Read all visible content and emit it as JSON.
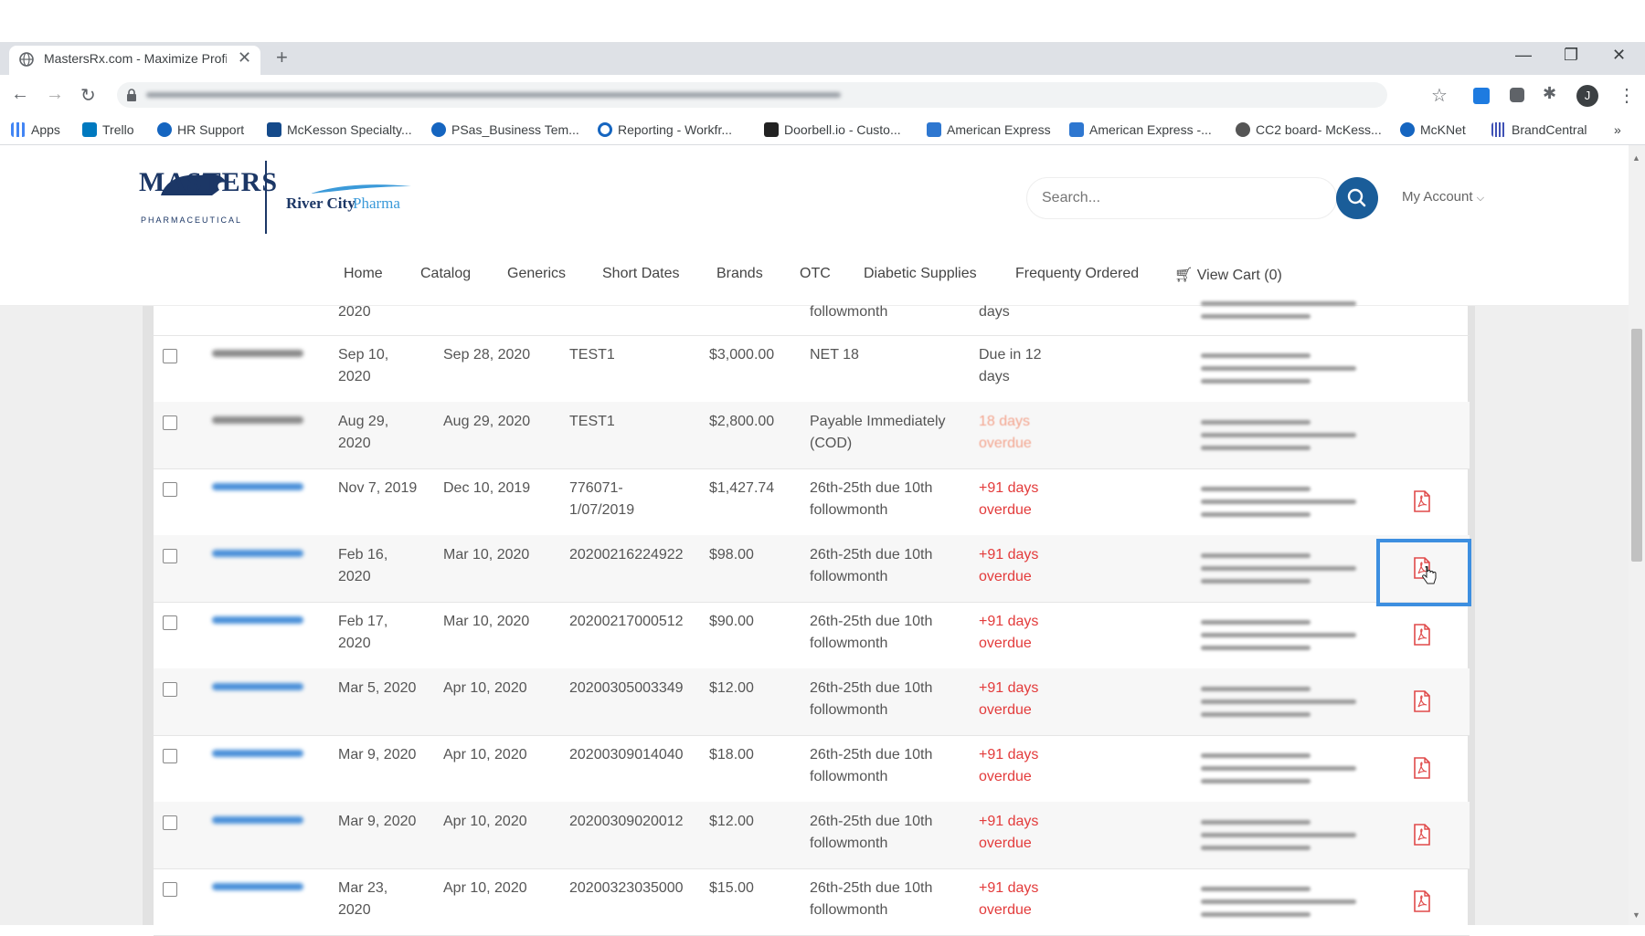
{
  "browser": {
    "tab_title": "MastersRx.com - Maximize Profit",
    "bookmarks": [
      "Apps",
      "Trello",
      "HR Support",
      "McKesson Specialty...",
      "PSas_Business Tem...",
      "Reporting - Workfr...",
      "Doorbell.io - Custo...",
      "American Express",
      "American Express -...",
      "CC2 board- McKess...",
      "McKNet",
      "BrandCentral"
    ],
    "profile_initial": "J"
  },
  "header": {
    "logo_masters": "MASTERS",
    "logo_masters_sub": "PHARMACEUTICAL",
    "logo_rcp_bold": "River City",
    "logo_rcp_light": "Pharma",
    "search_placeholder": "Search...",
    "my_account": "My Account"
  },
  "nav": [
    "Home",
    "Catalog",
    "Generics",
    "Short Dates",
    "Brands",
    "OTC",
    "Diabetic Supplies",
    "Frequenty Ordered",
    "View Cart (0)"
  ],
  "partial_row": {
    "date_line2": "2020",
    "terms_line2": "followmonth",
    "status_line2": "days"
  },
  "rows": [
    {
      "inv_date": [
        "Sep 10,",
        "2020"
      ],
      "due_date": "Sep 28, 2020",
      "ref": [
        "TEST1"
      ],
      "amount": "$3,000.00",
      "terms": [
        "NET 18"
      ],
      "status": [
        "Due in 12",
        "days"
      ],
      "status_type": "normal",
      "pdf": false
    },
    {
      "inv_date": [
        "Aug 29,",
        "2020"
      ],
      "due_date": "Aug 29, 2020",
      "ref": [
        "TEST1"
      ],
      "amount": "$2,800.00",
      "terms": [
        "Payable Immediately",
        "(COD)"
      ],
      "status": [
        "18 days",
        "overdue"
      ],
      "status_type": "faint",
      "pdf": false
    },
    {
      "inv_date": [
        "Nov 7, 2019"
      ],
      "due_date": "Dec 10, 2019",
      "ref": [
        "776071-",
        "1/07/2019"
      ],
      "amount": "$1,427.74",
      "terms": [
        "26th-25th due 10th",
        "followmonth"
      ],
      "status": [
        "+91 days",
        "overdue"
      ],
      "status_type": "overdue",
      "pdf": true
    },
    {
      "inv_date": [
        "Feb 16,",
        "2020"
      ],
      "due_date": "Mar 10, 2020",
      "ref": [
        "20200216224922"
      ],
      "amount": "$98.00",
      "terms": [
        "26th-25th due 10th",
        "followmonth"
      ],
      "status": [
        "+91 days",
        "overdue"
      ],
      "status_type": "overdue",
      "pdf": true
    },
    {
      "inv_date": [
        "Feb 17,",
        "2020"
      ],
      "due_date": "Mar 10, 2020",
      "ref": [
        "20200217000512"
      ],
      "amount": "$90.00",
      "terms": [
        "26th-25th due 10th",
        "followmonth"
      ],
      "status": [
        "+91 days",
        "overdue"
      ],
      "status_type": "overdue",
      "pdf": true
    },
    {
      "inv_date": [
        "Mar 5, 2020"
      ],
      "due_date": "Apr 10, 2020",
      "ref": [
        "20200305003349"
      ],
      "amount": "$12.00",
      "terms": [
        "26th-25th due 10th",
        "followmonth"
      ],
      "status": [
        "+91 days",
        "overdue"
      ],
      "status_type": "overdue",
      "pdf": true
    },
    {
      "inv_date": [
        "Mar 9, 2020"
      ],
      "due_date": "Apr 10, 2020",
      "ref": [
        "20200309014040"
      ],
      "amount": "$18.00",
      "terms": [
        "26th-25th due 10th",
        "followmonth"
      ],
      "status": [
        "+91 days",
        "overdue"
      ],
      "status_type": "overdue",
      "pdf": true
    },
    {
      "inv_date": [
        "Mar 9, 2020"
      ],
      "due_date": "Apr 10, 2020",
      "ref": [
        "20200309020012"
      ],
      "amount": "$12.00",
      "terms": [
        "26th-25th due 10th",
        "followmonth"
      ],
      "status": [
        "+91 days",
        "overdue"
      ],
      "status_type": "overdue",
      "pdf": true
    },
    {
      "inv_date": [
        "Mar 23,",
        "2020"
      ],
      "due_date": "Apr 10, 2020",
      "ref": [
        "20200323035000"
      ],
      "amount": "$15.00",
      "terms": [
        "26th-25th due 10th",
        "followmonth"
      ],
      "status": [
        "+91 days",
        "overdue"
      ],
      "status_type": "overdue",
      "pdf": true
    }
  ],
  "colors": {
    "brand_navy": "#1c3766",
    "search_button": "#1a5d99",
    "overdue": "#e33b3b",
    "pdf_red": "#e04a4a",
    "highlight": "#3d8fe0"
  }
}
